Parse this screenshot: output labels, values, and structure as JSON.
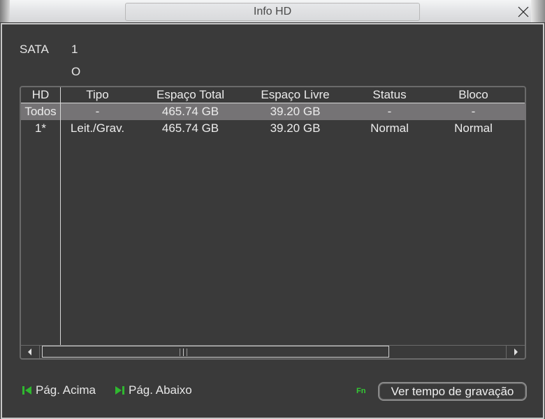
{
  "window": {
    "title": "Info HD",
    "close_icon": "close-icon"
  },
  "info": {
    "sata_label": "SATA",
    "sata_value": "1",
    "status_symbol": "O"
  },
  "table": {
    "columns": [
      "HD",
      "Tipo",
      "Espaço Total",
      "Espaço Livre",
      "Status",
      "Bloco"
    ],
    "rows": [
      {
        "hd": "Todos",
        "tipo": "-",
        "total": "465.74 GB",
        "livre": "39.20 GB",
        "status": "-",
        "bloco": "-",
        "selected": true
      },
      {
        "hd": "1*",
        "tipo": "Leit./Grav.",
        "total": "465.74 GB",
        "livre": "39.20 GB",
        "status": "Normal",
        "bloco": "Normal",
        "selected": false
      }
    ]
  },
  "footer": {
    "page_up_label": "Pág. Acima",
    "page_down_label": "Pág. Abaixo",
    "fn_label": "Fn",
    "record_time_button": "Ver tempo de gravação"
  },
  "colors": {
    "accent_green": "#33cc33",
    "selected_row": "#757375",
    "background": "#3a3a3a"
  }
}
